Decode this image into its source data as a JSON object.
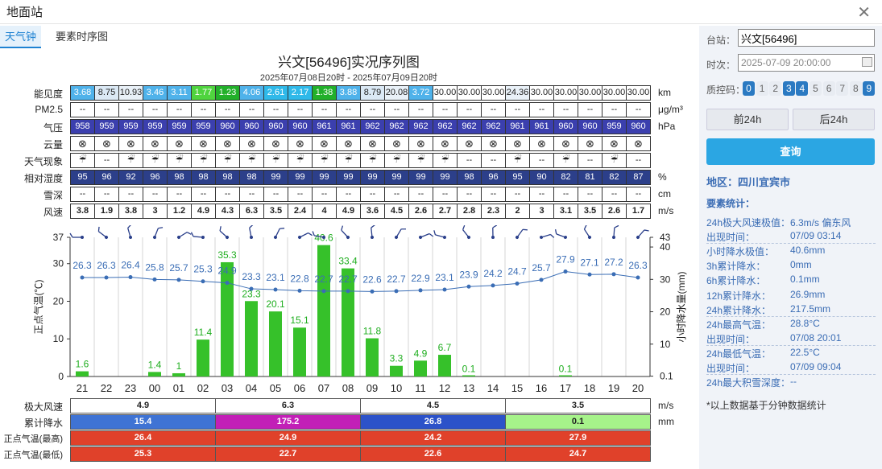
{
  "window": {
    "title": "地面站"
  },
  "tabs": [
    {
      "label": "天气钟"
    },
    {
      "label": "要素时序图"
    }
  ],
  "chart": {
    "title": "兴文[56496]实况序列图",
    "subtitle": "2025年07月08日20时 - 2025年07月09日20时"
  },
  "hours": [
    "21",
    "22",
    "23",
    "00",
    "01",
    "02",
    "03",
    "04",
    "05",
    "06",
    "07",
    "08",
    "09",
    "10",
    "11",
    "12",
    "13",
    "14",
    "15",
    "16",
    "17",
    "18",
    "19",
    "20"
  ],
  "rows": [
    {
      "label": "能见度",
      "unit": "km",
      "values": [
        "3.68",
        "8.75",
        "10.93",
        "3.46",
        "3.11",
        "1.77",
        "1.23",
        "4.06",
        "2.61",
        "2.17",
        "1.38",
        "3.88",
        "8.79",
        "20.08",
        "3.72",
        "30.00",
        "30.00",
        "30.00",
        "24.36",
        "30.00",
        "30.00",
        "30.00",
        "30.00",
        "30.00"
      ]
    },
    {
      "label": "PM2.5",
      "unit": "μg/m³",
      "values": [
        "--",
        "--",
        "--",
        "--",
        "--",
        "--",
        "--",
        "--",
        "--",
        "--",
        "--",
        "--",
        "--",
        "--",
        "--",
        "--",
        "--",
        "--",
        "--",
        "--",
        "--",
        "--",
        "--",
        "--"
      ]
    },
    {
      "label": "气压",
      "unit": "hPa",
      "values": [
        "958",
        "959",
        "959",
        "959",
        "959",
        "959",
        "960",
        "960",
        "960",
        "960",
        "961",
        "961",
        "962",
        "962",
        "962",
        "962",
        "962",
        "962",
        "961",
        "961",
        "960",
        "960",
        "959",
        "960"
      ]
    },
    {
      "label": "云量",
      "unit": "",
      "values": [
        "⊗",
        "⊗",
        "⊗",
        "⊗",
        "⊗",
        "⊗",
        "⊗",
        "⊗",
        "⊗",
        "⊗",
        "⊗",
        "⊗",
        "⊗",
        "⊗",
        "⊗",
        "⊗",
        "⊗",
        "⊗",
        "⊗",
        "⊗",
        "⊗",
        "⊗",
        "⊗",
        "⊗"
      ]
    },
    {
      "label": "天气现象",
      "unit": "",
      "values": [
        "☔",
        "--",
        "☔",
        "☔",
        "☔",
        "☔",
        "☔",
        "☔",
        "☔",
        "☔",
        "☔",
        "☔",
        "☔",
        "☔",
        "☔",
        "☔",
        "--",
        "--",
        "☔",
        "--",
        "☔",
        "--",
        "☔",
        "--"
      ]
    },
    {
      "label": "相对湿度",
      "unit": "%",
      "values": [
        "95",
        "96",
        "92",
        "96",
        "98",
        "98",
        "98",
        "98",
        "99",
        "99",
        "99",
        "99",
        "99",
        "99",
        "99",
        "99",
        "98",
        "96",
        "95",
        "90",
        "82",
        "81",
        "82",
        "87"
      ]
    },
    {
      "label": "雪深",
      "unit": "cm",
      "values": [
        "--",
        "--",
        "--",
        "--",
        "--",
        "--",
        "--",
        "--",
        "--",
        "--",
        "--",
        "--",
        "--",
        "--",
        "--",
        "--",
        "--",
        "--",
        "--",
        "--",
        "--",
        "--",
        "--",
        "--"
      ]
    },
    {
      "label": "风速",
      "unit": "m/s",
      "values": [
        "3.8",
        "1.9",
        "3.8",
        "3",
        "1.2",
        "4.9",
        "4.3",
        "6.3",
        "3.5",
        "2.4",
        "4",
        "4.9",
        "3.6",
        "4.5",
        "2.6",
        "2.7",
        "2.8",
        "2.3",
        "2",
        "3",
        "3.1",
        "3.5",
        "2.6",
        "1.7"
      ]
    }
  ],
  "chart_data": {
    "type": "bar",
    "categories": [
      "21",
      "22",
      "23",
      "00",
      "01",
      "02",
      "03",
      "04",
      "05",
      "06",
      "07",
      "08",
      "09",
      "10",
      "11",
      "12",
      "13",
      "14",
      "15",
      "16",
      "17",
      "18",
      "19",
      "20"
    ],
    "series": [
      {
        "values": [
          1.6,
          0,
          0,
          1.4,
          1,
          11.4,
          35.3,
          23.3,
          20.1,
          15.1,
          40.6,
          33.4,
          11.8,
          3.3,
          4.9,
          6.7,
          0.1,
          0,
          0,
          0,
          0.1,
          0,
          0,
          0
        ]
      },
      {
        "values": [
          26.3,
          26.3,
          26.4,
          25.8,
          25.7,
          25.3,
          24.9,
          23.3,
          23.1,
          22.8,
          22.7,
          22.7,
          22.6,
          22.7,
          22.9,
          23.1,
          23.9,
          24.2,
          24.7,
          25.7,
          27.9,
          27.1,
          27.2,
          26.3
        ]
      }
    ],
    "bar_labels": [
      "1.6",
      "",
      "",
      "1.4",
      "1",
      "11.4",
      "35.3",
      "23.3",
      "20.1",
      "15.1",
      "40.6",
      "33.4",
      "11.8",
      "3.3",
      "4.9",
      "6.7",
      "0.1",
      "",
      "",
      "",
      "0.1",
      "",
      "",
      ""
    ],
    "line_labels": [
      "26.3",
      "26.3",
      "26.4",
      "25.8",
      "25.7",
      "25.3",
      "24.9",
      "23.3",
      "23.1",
      "22.8",
      "22.7",
      "22.7",
      "22.6",
      "22.7",
      "22.9",
      "23.1",
      "23.9",
      "24.2",
      "24.7",
      "25.7",
      "27.9",
      "27.1",
      "27.2",
      "26.3"
    ],
    "left_ticks": [
      "37",
      "30",
      "20",
      "10",
      "0"
    ],
    "right_ticks": [
      "43",
      "40",
      "30",
      "20",
      "10",
      "0.1"
    ],
    "ylabel": "正点气温(℃)",
    "y2label": "小时降水量(mm)"
  },
  "summary": [
    {
      "label": "极大风速",
      "unit": "m/s",
      "values": [
        "4.9",
        "6.3",
        "4.5",
        "3.5"
      ],
      "colors": [
        "#ffffff",
        "#ffffff",
        "#ffffff",
        "#ffffff"
      ],
      "textcolor": "#222"
    },
    {
      "label": "累计降水",
      "unit": "mm",
      "values": [
        "15.4",
        "175.2",
        "26.8",
        "0.1"
      ],
      "colors": [
        "#3f73d4",
        "#c21fb7",
        "#2c52c9",
        "#a6f38a"
      ],
      "textcolor": "#fff"
    },
    {
      "label": "正点气温(最高)",
      "unit": "",
      "values": [
        "26.4",
        "24.9",
        "24.2",
        "27.9"
      ],
      "colors": [
        "#e0412a",
        "#e0412a",
        "#e0412a",
        "#e0412a"
      ],
      "textcolor": "#fff"
    },
    {
      "label": "正点气温(最低)",
      "unit": "",
      "values": [
        "25.3",
        "22.7",
        "22.6",
        "24.7"
      ],
      "colors": [
        "#e0412a",
        "#e0412a",
        "#e0412a",
        "#e0412a"
      ],
      "textcolor": "#fff"
    }
  ],
  "sidebar": {
    "station_label": "台站：",
    "station_value": "兴文[56496]",
    "time_label": "时次：",
    "time_value": "2025-07-09 20:00:00",
    "qc_label": "质控码：",
    "qc_codes": [
      {
        "code": "0",
        "on": true
      },
      {
        "code": "1",
        "on": false
      },
      {
        "code": "2",
        "on": false
      },
      {
        "code": "3",
        "on": true
      },
      {
        "code": "4",
        "on": true
      },
      {
        "code": "5",
        "on": false
      },
      {
        "code": "6",
        "on": false
      },
      {
        "code": "7",
        "on": false
      },
      {
        "code": "8",
        "on": false
      },
      {
        "code": "9",
        "on": true
      }
    ],
    "prev_label": "前24h",
    "next_label": "后24h",
    "query_label": "查询",
    "region": "地区：四川宜宾市",
    "stats_title": "要素统计：",
    "stats": [
      {
        "k": "24h极大风速极值：",
        "v": "6.3m/s 偏东风"
      },
      {
        "k": "出现时间：",
        "v": "07/09 03:14"
      },
      {
        "k": "小时降水极值：",
        "v": "40.6mm"
      },
      {
        "k": "3h累计降水：",
        "v": "0mm"
      },
      {
        "k": "6h累计降水：",
        "v": "0.1mm"
      },
      {
        "k": "12h累计降水：",
        "v": "26.9mm"
      },
      {
        "k": "24h累计降水：",
        "v": "217.5mm"
      },
      {
        "k": "24h最高气温：",
        "v": "28.8°C"
      },
      {
        "k": "出现时间：",
        "v": "07/08 20:01"
      },
      {
        "k": "24h最低气温：",
        "v": "22.5°C"
      },
      {
        "k": "出现时间：",
        "v": "07/09 09:04"
      },
      {
        "k": "24h最大积雪深度：",
        "v": "--"
      }
    ],
    "footnote": "*以上数据基于分钟数据统计"
  },
  "colors": {
    "accent": "#1e82d2",
    "bar": "#36c12a",
    "line": "#3a6db5",
    "pressure": "#3b3fae",
    "humidity": "#2c3f8a"
  }
}
